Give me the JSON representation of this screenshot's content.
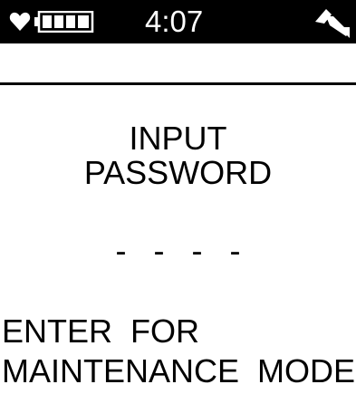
{
  "status_bar": {
    "time": "4:07",
    "heart_icon": "heart-icon",
    "battery_icon": "battery-full-icon",
    "battery_level": 1.0,
    "signal_icon": "signal-icon"
  },
  "main": {
    "prompt_line_1": "INPUT",
    "prompt_line_2": "PASSWORD",
    "pin_placeholders": [
      "-",
      "-",
      "-",
      "-"
    ]
  },
  "footer": {
    "line_1": "ENTER  FOR",
    "line_2": "MAINTENANCE  MODE"
  },
  "colors": {
    "background": "#ffffff",
    "status_bar": "#000000",
    "foreground": "#000000",
    "status_text": "#ffffff"
  }
}
